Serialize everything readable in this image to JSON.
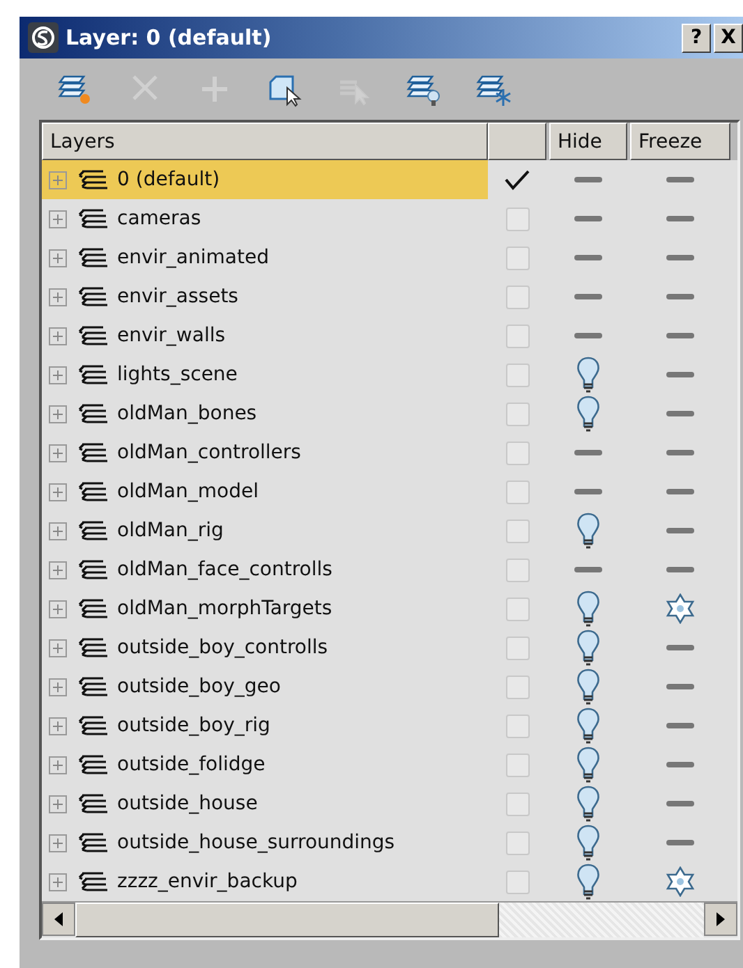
{
  "window": {
    "title": "Layer: 0 (default)",
    "help_button": "?",
    "close_button": "X"
  },
  "toolbar": [
    {
      "kind": "new-layer",
      "disabled": false
    },
    {
      "kind": "delete",
      "disabled": true
    },
    {
      "kind": "add",
      "disabled": true
    },
    {
      "kind": "select-objects",
      "disabled": false
    },
    {
      "kind": "select-layer",
      "disabled": true
    },
    {
      "kind": "hide-layer",
      "disabled": false
    },
    {
      "kind": "freeze-layer",
      "disabled": false
    }
  ],
  "table": {
    "columns": [
      "Layers",
      "Hide",
      "Freeze"
    ],
    "rows": [
      {
        "name": "0 (default)",
        "selected": true,
        "current": true,
        "hidden": false,
        "frozen": false
      },
      {
        "name": "cameras",
        "selected": false,
        "current": false,
        "hidden": false,
        "frozen": false
      },
      {
        "name": "envir_animated",
        "selected": false,
        "current": false,
        "hidden": false,
        "frozen": false
      },
      {
        "name": "envir_assets",
        "selected": false,
        "current": false,
        "hidden": false,
        "frozen": false
      },
      {
        "name": "envir_walls",
        "selected": false,
        "current": false,
        "hidden": false,
        "frozen": false
      },
      {
        "name": "lights_scene",
        "selected": false,
        "current": false,
        "hidden": true,
        "frozen": false
      },
      {
        "name": "oldMan_bones",
        "selected": false,
        "current": false,
        "hidden": true,
        "frozen": false
      },
      {
        "name": "oldMan_controllers",
        "selected": false,
        "current": false,
        "hidden": false,
        "frozen": false
      },
      {
        "name": "oldMan_model",
        "selected": false,
        "current": false,
        "hidden": false,
        "frozen": false
      },
      {
        "name": "oldMan_rig",
        "selected": false,
        "current": false,
        "hidden": true,
        "frozen": false
      },
      {
        "name": "oldMan_face_controlls",
        "selected": false,
        "current": false,
        "hidden": false,
        "frozen": false
      },
      {
        "name": "oldMan_morphTargets",
        "selected": false,
        "current": false,
        "hidden": true,
        "frozen": true
      },
      {
        "name": "outside_boy_controlls",
        "selected": false,
        "current": false,
        "hidden": true,
        "frozen": false
      },
      {
        "name": "outside_boy_geo",
        "selected": false,
        "current": false,
        "hidden": true,
        "frozen": false
      },
      {
        "name": "outside_boy_rig",
        "selected": false,
        "current": false,
        "hidden": true,
        "frozen": false
      },
      {
        "name": "outside_folidge",
        "selected": false,
        "current": false,
        "hidden": true,
        "frozen": false
      },
      {
        "name": "outside_house",
        "selected": false,
        "current": false,
        "hidden": true,
        "frozen": false
      },
      {
        "name": "outside_house_surroundings",
        "selected": false,
        "current": false,
        "hidden": true,
        "frozen": false
      },
      {
        "name": "zzzz_envir_backup",
        "selected": false,
        "current": false,
        "hidden": true,
        "frozen": true
      }
    ]
  }
}
